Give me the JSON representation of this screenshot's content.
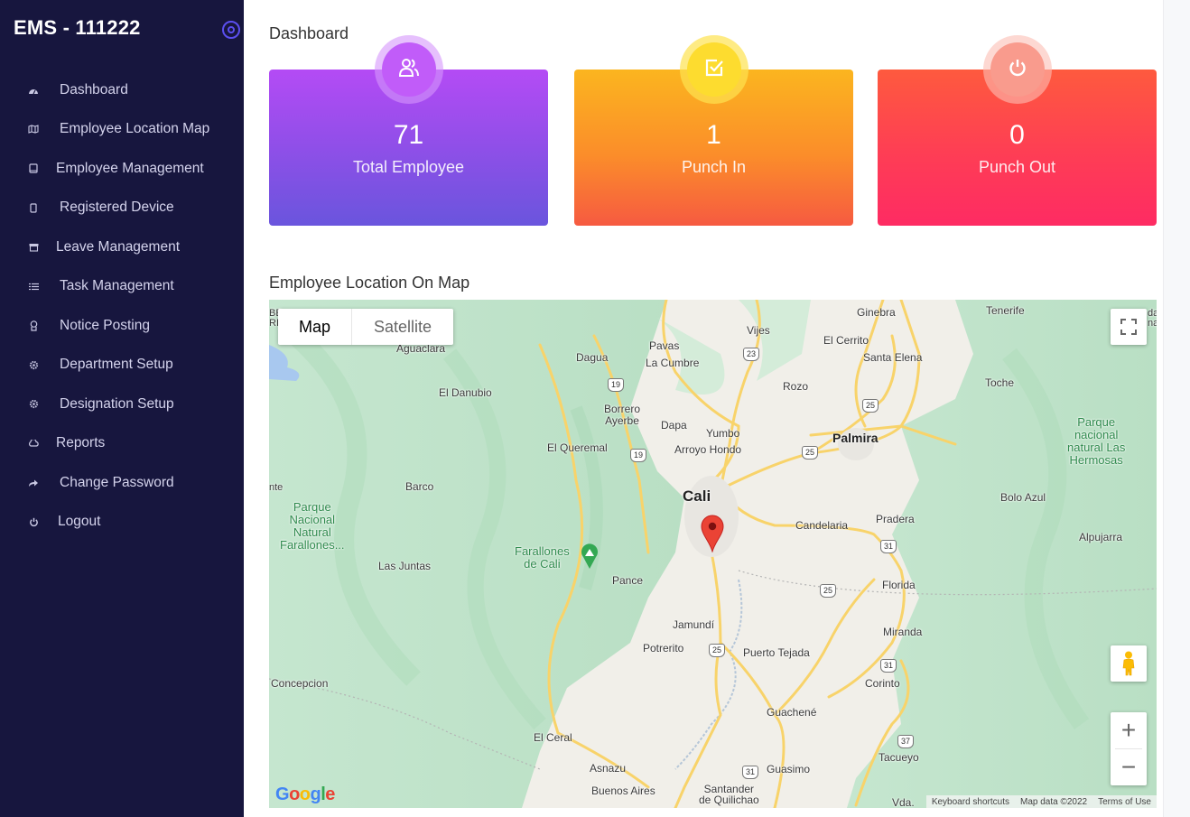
{
  "sidebar": {
    "brand": "EMS - 111222",
    "toggle_icon": "target-circle-icon",
    "items": [
      {
        "label": "Dashboard",
        "icon": "dashboard-gauge-icon"
      },
      {
        "label": "Employee Location Map",
        "icon": "map-icon"
      },
      {
        "label": "Employee Management",
        "icon": "tablet-icon"
      },
      {
        "label": "Registered Device",
        "icon": "device-icon"
      },
      {
        "label": "Leave Management",
        "icon": "archive-icon"
      },
      {
        "label": "Task Management",
        "icon": "list-icon"
      },
      {
        "label": "Notice Posting",
        "icon": "award-icon"
      },
      {
        "label": "Department Setup",
        "icon": "gear-icon"
      },
      {
        "label": "Designation Setup",
        "icon": "gear-icon"
      },
      {
        "label": "Reports",
        "icon": "cloud-icon"
      },
      {
        "label": "Change Password",
        "icon": "share-arrow-icon"
      },
      {
        "label": "Logout",
        "icon": "power-icon"
      }
    ]
  },
  "main": {
    "title": "Dashboard",
    "cards": [
      {
        "value": "71",
        "label": "Total Employee",
        "icon": "users-icon",
        "color": "#a14ef0"
      },
      {
        "value": "1",
        "label": "Punch In",
        "icon": "checkbox-edit-icon",
        "color": "#fb9a27"
      },
      {
        "value": "0",
        "label": "Punch Out",
        "icon": "power-icon",
        "color": "#fe3d55"
      }
    ],
    "map_section_title": "Employee Location On Map"
  },
  "map": {
    "type_controls": {
      "map": "Map",
      "satellite": "Satellite",
      "selected": "Map"
    },
    "zoom_in": "+",
    "zoom_out": "−",
    "logo": [
      "G",
      "o",
      "o",
      "g",
      "l",
      "e"
    ],
    "attribution": {
      "keyboard": "Keyboard shortcuts",
      "data": "Map data ©2022",
      "terms": "Terms of Use"
    },
    "labels": {
      "cali": "Cali",
      "palmira": "Palmira",
      "ginebra": "Ginebra",
      "tenerife": "Tenerife",
      "vijes": "Vijes",
      "el_cerrito": "El Cerrito",
      "santa_elena": "Santa Elena",
      "pavas": "Pavas",
      "la_cumbre": "La Cumbre",
      "dagua": "Dagua",
      "aguaclara": "Aguaclara",
      "el_danubio": "El Danubio",
      "rozo": "Rozo",
      "toche": "Toche",
      "borrero_ayerbe": "Borrero\nAyerbe",
      "dapa": "Dapa",
      "yumbo": "Yumbo",
      "arroyo_hondo": "Arroyo Hondo",
      "el_queremal": "El Queremal",
      "parque_las_hermosas": "Parque\nnacional\nnatural Las\nHermosas",
      "barco": "Barco",
      "nte": "nte",
      "parque_farallones": "Parque\nNacional\nNatural\nFarallones...",
      "bolo_azul": "Bolo Azul",
      "candelaria": "Candelaria",
      "pradera": "Pradera",
      "alpujarra": "Alpujarra",
      "farallones_de_cali": "Farallones\nde Cali",
      "las_juntas": "Las Juntas",
      "pance": "Pance",
      "florida": "Florida",
      "jamundi": "Jamundí",
      "miranda": "Miranda",
      "potrerito": "Potrerito",
      "puerto_tejada": "Puerto Tejada",
      "concepcion": "Concepcion",
      "corinto": "Corinto",
      "guachene": "Guachené",
      "el_ceral": "El Ceral",
      "tacueyo": "Tacueyo",
      "asnazu": "Asnazu",
      "guasimo": "Guasimo",
      "buenos_aires": "Buenos Aires",
      "santander": "Santander\nde Quilichao",
      "vda": "Vda.",
      "edge_be": "BE\nRI",
      "edge_da": "da\nna"
    },
    "route_shields": [
      "19",
      "19",
      "23",
      "25",
      "25",
      "25",
      "25",
      "31",
      "31",
      "31",
      "37"
    ],
    "marker_color": "#ea4335"
  }
}
